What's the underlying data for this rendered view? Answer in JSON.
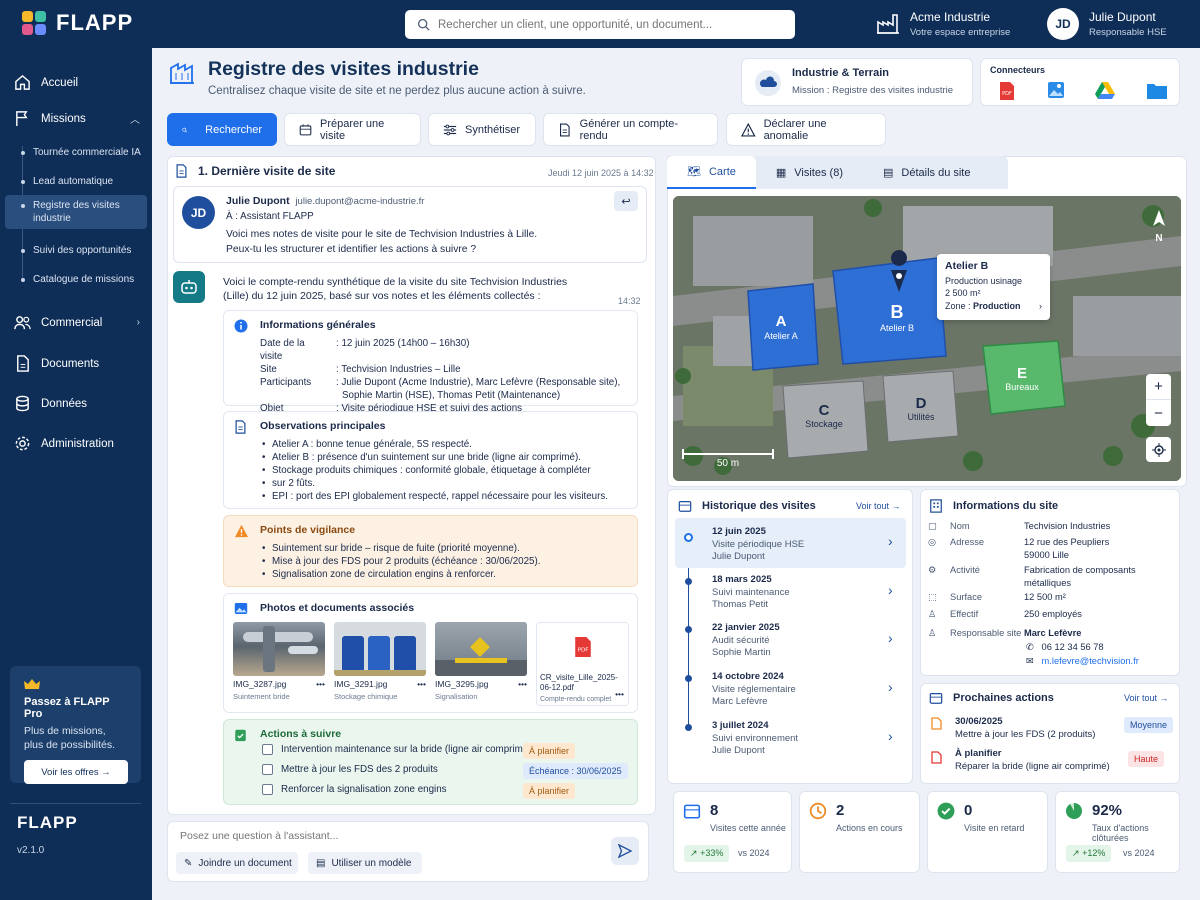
{
  "app": {
    "name": "FLAPP",
    "version": "v2.1.0"
  },
  "search": {
    "placeholder": "Rechercher un client, une opportunité, un document..."
  },
  "company": {
    "name": "Acme Industrie",
    "subtitle": "Votre espace entreprise"
  },
  "user": {
    "initials": "JD",
    "name": "Julie Dupont",
    "role": "Responsable HSE"
  },
  "sidebar": {
    "items": [
      {
        "label": "Accueil"
      },
      {
        "label": "Missions"
      },
      {
        "label": "Commercial"
      },
      {
        "label": "Documents"
      },
      {
        "label": "Données"
      },
      {
        "label": "Administration"
      }
    ],
    "missions": [
      {
        "label": "Tournée commerciale IA"
      },
      {
        "label": "Lead automatique"
      },
      {
        "label": "Registre des visites industrie"
      },
      {
        "label": "Suivi des opportunités"
      },
      {
        "label": "Catalogue de missions"
      }
    ],
    "pro": {
      "title": "Passez à FLAPP Pro",
      "desc1": "Plus de missions,",
      "desc2": "plus de possibilités.",
      "button": "Voir les offres"
    }
  },
  "header": {
    "title": "Registre des visites industrie",
    "subtitle": "Centralisez chaque visite de site et ne perdez plus aucune action à suivre.",
    "context_title": "Industrie & Terrain",
    "context_sub": "Mission : Registre des visites industrie",
    "connectors_label": "Connecteurs"
  },
  "toolbar": {
    "search": "Rechercher",
    "prepare": "Préparer une visite",
    "synth": "Synthétiser",
    "report": "Générer un compte-rendu",
    "anomaly": "Déclarer une anomalie"
  },
  "chat": {
    "header": "1. Dernière visite de site",
    "header_date": "Jeudi 12 juin 2025 à 14:32",
    "msg": {
      "initials": "JD",
      "from": "Julie Dupont",
      "email": "julie.dupont@acme-industrie.fr",
      "to": "À : Assistant FLAPP",
      "line1": "Voici mes notes de visite pour le site de Techvision Industries à Lille.",
      "line2": "Peux-tu les structurer et identifier les actions à suivre ?"
    },
    "reply": {
      "line1": "Voici le compte-rendu synthétique de la visite du site Techvision Industries",
      "line2": "(Lille) du 12 juin 2025, basé sur vos notes et les éléments collectés :",
      "time": "14:32"
    },
    "general": {
      "title": "Informations générales",
      "rows": [
        {
          "k": "Date de la visite",
          "v": ": 12 juin 2025 (14h00 – 16h30)"
        },
        {
          "k": "Site",
          "v": ": Techvision Industries – Lille"
        },
        {
          "k": "Participants",
          "v": ": Julie Dupont (Acme Industrie), Marc Lefèvre (Responsable site),"
        },
        {
          "k": "",
          "v": "Sophie Martin (HSE), Thomas Petit (Maintenance)"
        },
        {
          "k": "Objet",
          "v": ": Visite périodique HSE et suivi des actions"
        }
      ]
    },
    "observations": {
      "title": "Observations principales",
      "items": [
        {
          "b": "Atelier A",
          "t": " : bonne tenue générale, 5S respecté."
        },
        {
          "b": "Atelier B",
          "t": " : présence d'un suintement sur une bride (ligne air comprimé)."
        },
        {
          "b": "Stockage produits chimiques",
          "t": " : conformité globale, étiquetage à compléter"
        },
        {
          "b": "",
          "t": "sur 2 fûts."
        },
        {
          "b": "EPI",
          "t": " : port des EPI globalement respecté, rappel nécessaire pour les visiteurs."
        }
      ]
    },
    "vigilance": {
      "title": "Points de vigilance",
      "items": [
        "Suintement sur bride – risque de fuite (priorité moyenne).",
        "Mise à jour des FDS pour 2 produits (échéance : 30/06/2025).",
        "Signalisation zone de circulation engins à renforcer."
      ]
    },
    "photos": {
      "title": "Photos et documents associés",
      "items": [
        {
          "name": "IMG_3287.jpg",
          "sub": "Suintement bride"
        },
        {
          "name": "IMG_3291.jpg",
          "sub": "Stockage chimique"
        },
        {
          "name": "IMG_3295.jpg",
          "sub": "Signalisation"
        },
        {
          "name": "CR_visite_Lille_2025-06-12.pdf",
          "sub": "Compte-rendu complet",
          "badge": "PDF"
        }
      ]
    },
    "actions": {
      "title": "Actions à suivre",
      "items": [
        {
          "label": "Intervention maintenance sur la bride (ligne air comprimé)",
          "tag": "À planifier"
        },
        {
          "label": "Mettre à jour les FDS des 2 produits",
          "tag": "Échéance : 30/06/2025"
        },
        {
          "label": "Renforcer la signalisation zone engins",
          "tag": "À planifier"
        }
      ]
    },
    "input_placeholder": "Posez une question à l'assistant...",
    "attach": "Joindre un document",
    "template": "Utiliser un modèle"
  },
  "tabs": [
    {
      "label": "Carte"
    },
    {
      "label": "Visites (8)"
    },
    {
      "label": "Détails du site"
    }
  ],
  "map": {
    "buildings": [
      {
        "letter": "A",
        "name": "Atelier A"
      },
      {
        "letter": "B",
        "name": "Atelier B"
      },
      {
        "letter": "C",
        "name": "Stockage"
      },
      {
        "letter": "D",
        "name": "Utilités"
      },
      {
        "letter": "E",
        "name": "Bureaux"
      }
    ],
    "popup": {
      "title": "Atelier B",
      "line1": "Production usinage",
      "line2": "2 500 m²",
      "zone_label": "Zone :",
      "zone": "Production"
    },
    "north": "N",
    "scale": "50 m",
    "zoom_in": "+",
    "zoom_out": "−"
  },
  "history": {
    "title": "Historique des visites",
    "see_all": "Voir tout",
    "items": [
      {
        "date": "12 juin 2025",
        "type": "Visite périodique HSE",
        "person": "Julie Dupont"
      },
      {
        "date": "18 mars 2025",
        "type": "Suivi maintenance",
        "person": "Thomas Petit"
      },
      {
        "date": "22 janvier 2025",
        "type": "Audit sécurité",
        "person": "Sophie Martin"
      },
      {
        "date": "14 octobre 2024",
        "type": "Visite réglementaire",
        "person": "Marc Lefèvre"
      },
      {
        "date": "3 juillet 2024",
        "type": "Suivi environnement",
        "person": "Julie Dupont"
      }
    ]
  },
  "site_info": {
    "title": "Informations du site",
    "rows": [
      {
        "k": "Nom",
        "v": "Techvision Industries",
        "v2": ""
      },
      {
        "k": "Adresse",
        "v": "12 rue des Peupliers",
        "v2": "59000 Lille"
      },
      {
        "k": "Activité",
        "v": "Fabrication de composants",
        "v2": "métalliques"
      },
      {
        "k": "Surface",
        "v": "12 500 m²",
        "v2": ""
      },
      {
        "k": "Effectif",
        "v": "250 employés",
        "v2": ""
      }
    ],
    "manager_label": "Responsable site",
    "manager": "Marc Lefèvre",
    "phone": "06 12 34 56 78",
    "email": "m.lefevre@techvision.fr"
  },
  "next_actions": {
    "title": "Prochaines actions",
    "see_all": "Voir tout",
    "items": [
      {
        "date": "30/06/2025",
        "desc": "Mettre à jour les FDS (2 produits)",
        "tag": "Moyenne"
      },
      {
        "date": "À planifier",
        "desc": "Réparer la bride (ligne air comprimé)",
        "tag": "Haute"
      }
    ]
  },
  "stats": [
    {
      "num": "8",
      "label": "Visites cette année",
      "delta": "+33%",
      "vs": "vs 2024"
    },
    {
      "num": "2",
      "label": "Actions en cours",
      "delta": "",
      "vs": ""
    },
    {
      "num": "0",
      "label": "Visite en retard",
      "delta": "",
      "vs": ""
    },
    {
      "num": "92%",
      "label": "Taux d'actions clôturées",
      "delta": "+12%",
      "vs": "vs 2024",
      "fraction": 0.92
    }
  ],
  "colors": {
    "navy": "#0f2e57",
    "primary": "#1f6feb",
    "warn_bg": "#fdf1e4",
    "ok_bg": "#eaf6ee"
  }
}
